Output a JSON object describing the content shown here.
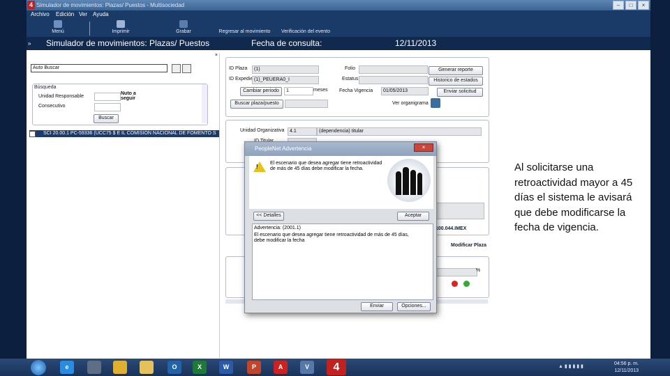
{
  "window": {
    "title": "Simulador de movimientos: Plazas/ Puestos - Multisociedad",
    "logo": "4"
  },
  "menubar": {
    "items": [
      "Archivo",
      "Edición",
      "Ver",
      "Ayuda"
    ]
  },
  "toolbar": {
    "menu": "Menú",
    "print": "Imprimir",
    "save": "Grabar",
    "back": "Regresar al movimiento",
    "verify": "Verificación del evento"
  },
  "header": {
    "title": "Simulador de movimientos: Plazas/ Puestos",
    "date_label": "Fecha de consulta:",
    "date_value": "12/11/2013"
  },
  "left": {
    "search_value": "Auto Buscar",
    "group_title": "Búsqueda",
    "unit_label": "Unidad Responsable",
    "consecutive_label": "Consecutivo",
    "hint": "Nuto a seguir",
    "search_button": "Buscar",
    "tree_item": "SCI 20.00.1 PC-59336 (UCC75 $ E IL COMISION NACIONAL DE FOMENTO S"
  },
  "form": {
    "id_label": "ID Plaza",
    "id_value": "(1)",
    "expediente_label": "ID Expediente",
    "expediente_value": "(1)_PEUERA0_I",
    "folio_label": "Folio",
    "estado_label": "Estatus",
    "plazo_button": "Cambiar periodo",
    "plazo_value": "1",
    "plazo_unit": "meses",
    "vigencia_label": "Fecha Vigencia",
    "vigencia_value": "01/05/2013",
    "report_button": "Generar reporte",
    "history_button": "Historico de estados",
    "send_button": "Enviar solicitud",
    "search_plaza_button": "Buscar plaza/puesto",
    "organigrama_label": "Ver organigrama",
    "unidad_label": "Unidad Organizativa",
    "unidad_code": "4.1",
    "unidad_value": "(dependencia) titular",
    "id_titular_label": "ID Titular",
    "status_right": "100.044.IMEX",
    "link_right": "Modificar Plaza",
    "percent": "%"
  },
  "dialog": {
    "title": "PeopleNet  Advertencia",
    "message": "El escenario que desea agregar tiene retroactividad de más de 45 días debe modificar la fecha.",
    "details_button": "<< Detalles",
    "accept_button": "Aceptar",
    "log_line1": "Advertencia: (2001.1)",
    "log_line2": "El escenario que desea agregar tiene retroactividad de más de 45 días, debe modificar la fecha",
    "send_button": "Enviar",
    "options_button": "Opciones..."
  },
  "taskbar": {
    "time": "04:56 p. m.",
    "date": "12/11/2013"
  },
  "note": {
    "text": "Al solicitarse una retroactividad mayor a 45 días el sistema le avisará que debe modificarse la fecha de vigencia."
  }
}
